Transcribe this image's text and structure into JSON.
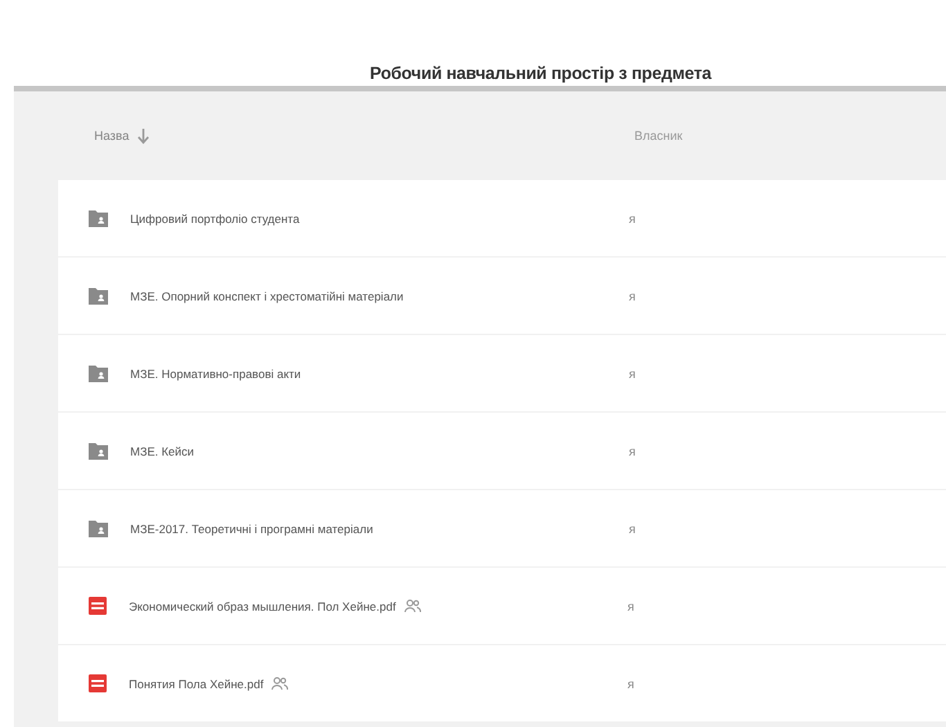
{
  "title": "Робочий навчальний простір з предмета",
  "table": {
    "columns": [
      {
        "label": "Назва",
        "sorted": true
      },
      {
        "label": "Власник",
        "sorted": false
      }
    ],
    "rows": [
      {
        "kind": "folder",
        "name": "Цифровий портфоліо студента",
        "shared": false,
        "owner": "я"
      },
      {
        "kind": "folder",
        "name": "МЗЕ. Опорний конспект і хрестоматійні матеріали",
        "shared": false,
        "owner": "я"
      },
      {
        "kind": "folder",
        "name": "МЗЕ. Нормативно-правові акти",
        "shared": false,
        "owner": "я"
      },
      {
        "kind": "folder",
        "name": "МЗЕ. Кейси",
        "shared": false,
        "owner": "я"
      },
      {
        "kind": "folder",
        "name": "МЗЕ-2017. Теоретичні і програмні матеріали",
        "shared": false,
        "owner": "я"
      },
      {
        "kind": "pdf",
        "name": "Экономический образ мышления. Пол Хейне.pdf",
        "shared": true,
        "owner": "я"
      },
      {
        "kind": "pdf",
        "name": "Понятия Пола Хейне.pdf",
        "shared": true,
        "owner": "я"
      }
    ]
  }
}
